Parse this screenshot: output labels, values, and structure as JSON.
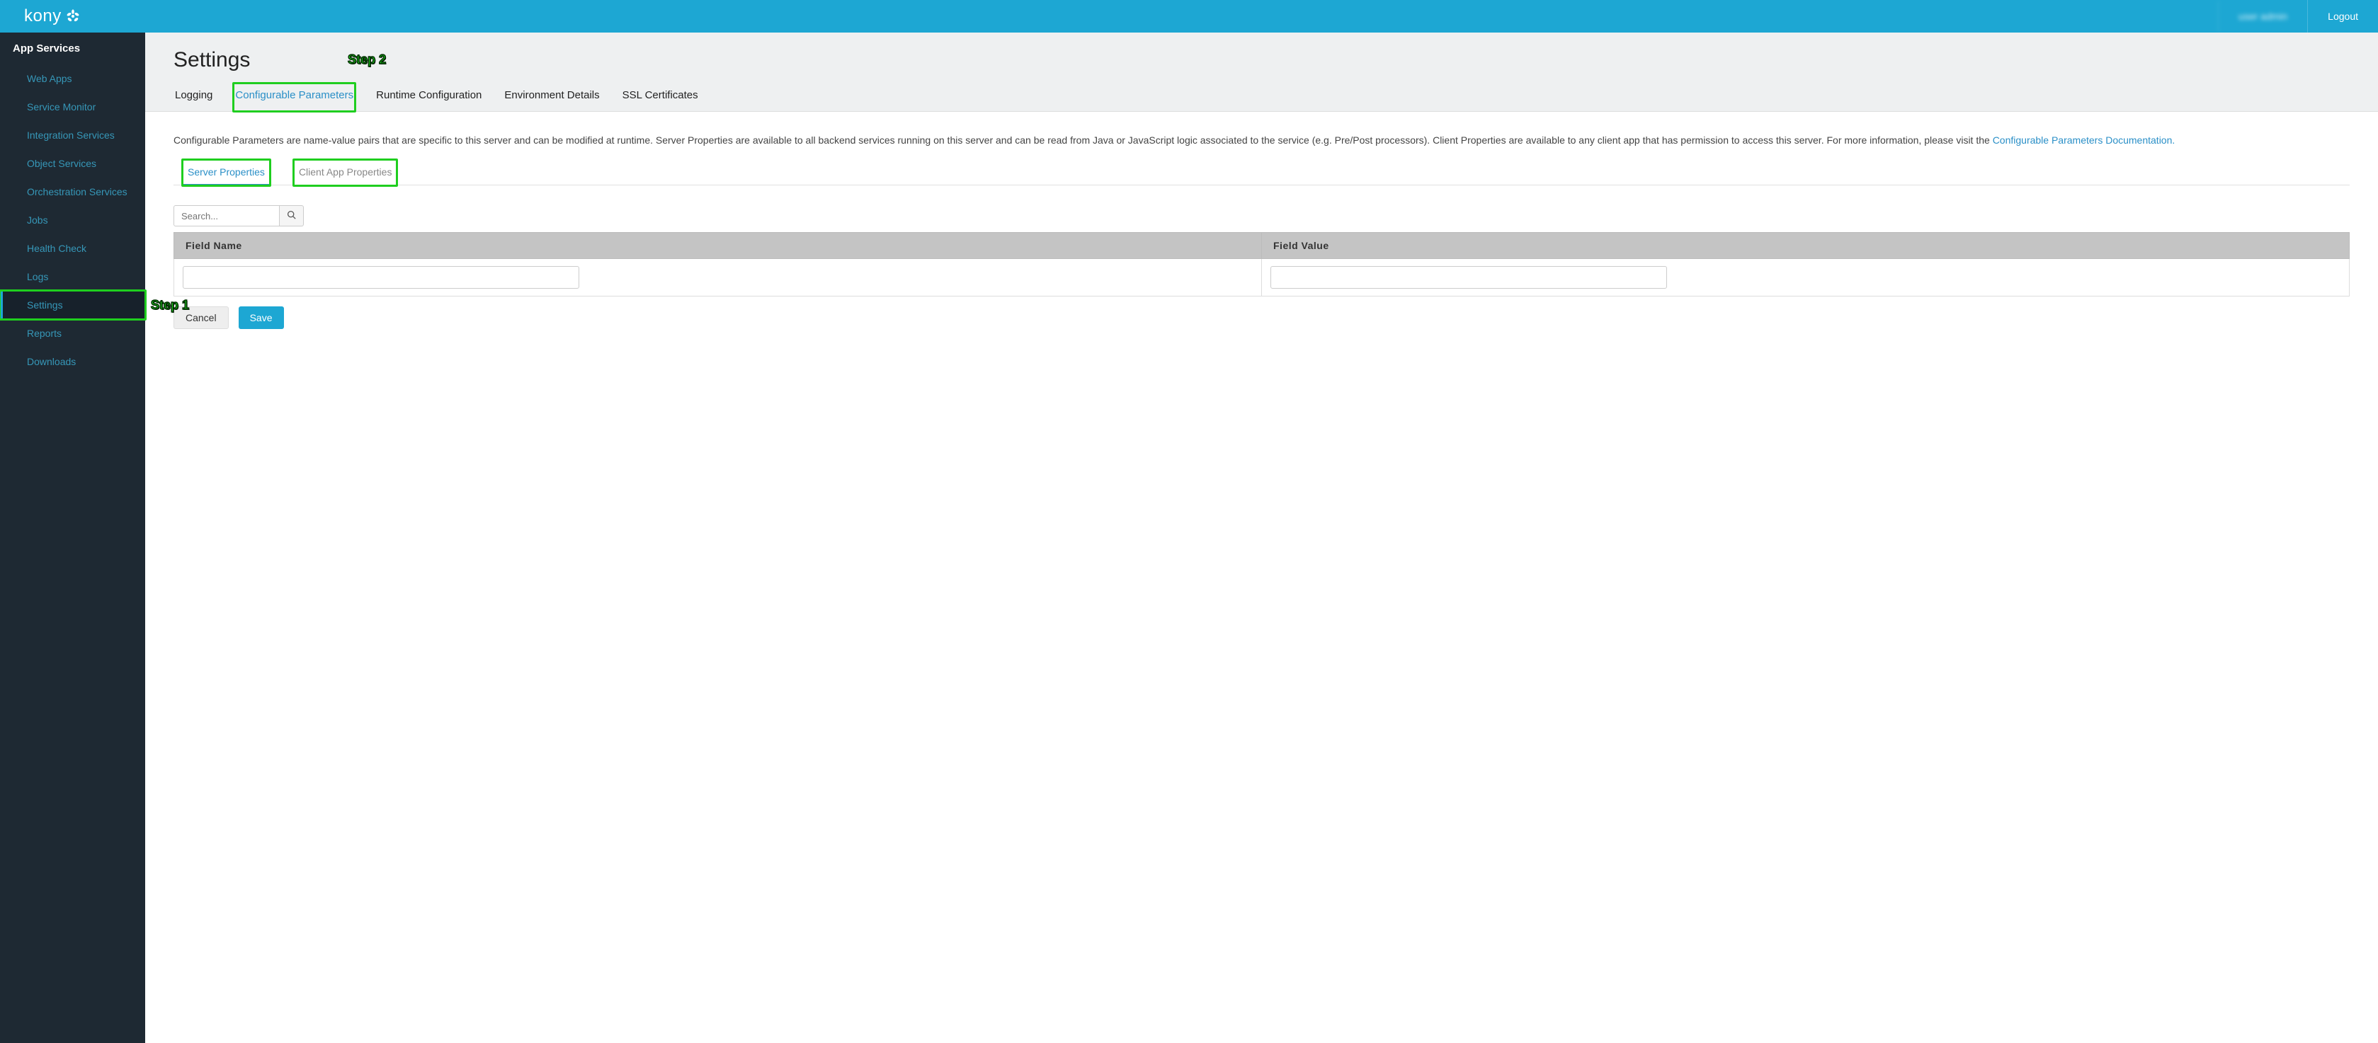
{
  "header": {
    "brand": "kony",
    "user": "user admin",
    "logout": "Logout"
  },
  "sidebar": {
    "title": "App Services",
    "items": [
      {
        "label": "Web Apps",
        "active": false
      },
      {
        "label": "Service Monitor",
        "active": false
      },
      {
        "label": "Integration Services",
        "active": false
      },
      {
        "label": "Object Services",
        "active": false
      },
      {
        "label": "Orchestration Services",
        "active": false
      },
      {
        "label": "Jobs",
        "active": false
      },
      {
        "label": "Health Check",
        "active": false
      },
      {
        "label": "Logs",
        "active": false
      },
      {
        "label": "Settings",
        "active": true
      },
      {
        "label": "Reports",
        "active": false
      },
      {
        "label": "Downloads",
        "active": false
      }
    ]
  },
  "page": {
    "title": "Settings",
    "tabs": [
      {
        "label": "Logging",
        "active": false
      },
      {
        "label": "Configurable Parameters",
        "active": true
      },
      {
        "label": "Runtime Configuration",
        "active": false
      },
      {
        "label": "Environment Details",
        "active": false
      },
      {
        "label": "SSL Certificates",
        "active": false
      }
    ],
    "description_pre": "Configurable Parameters are name-value pairs that are specific to this server and can be modified at runtime. Server Properties are available to all backend services running on this server and can be read from Java or JavaScript logic associated to the service (e.g. Pre/Post processors). Client Properties are available to any client app that has permission to access this server. For more information, please visit the ",
    "description_link": "Configurable Parameters Documentation.",
    "subtabs": [
      {
        "label": "Server Properties",
        "active": true
      },
      {
        "label": "Client App Properties",
        "active": false
      }
    ],
    "search_placeholder": "Search...",
    "table": {
      "col_name": "Field Name",
      "col_value": "Field Value",
      "rows": [
        {
          "name": "",
          "value": ""
        }
      ]
    },
    "buttons": {
      "cancel": "Cancel",
      "save": "Save"
    }
  },
  "annotations": {
    "step1": "Step 1",
    "step2": "Step 2"
  }
}
